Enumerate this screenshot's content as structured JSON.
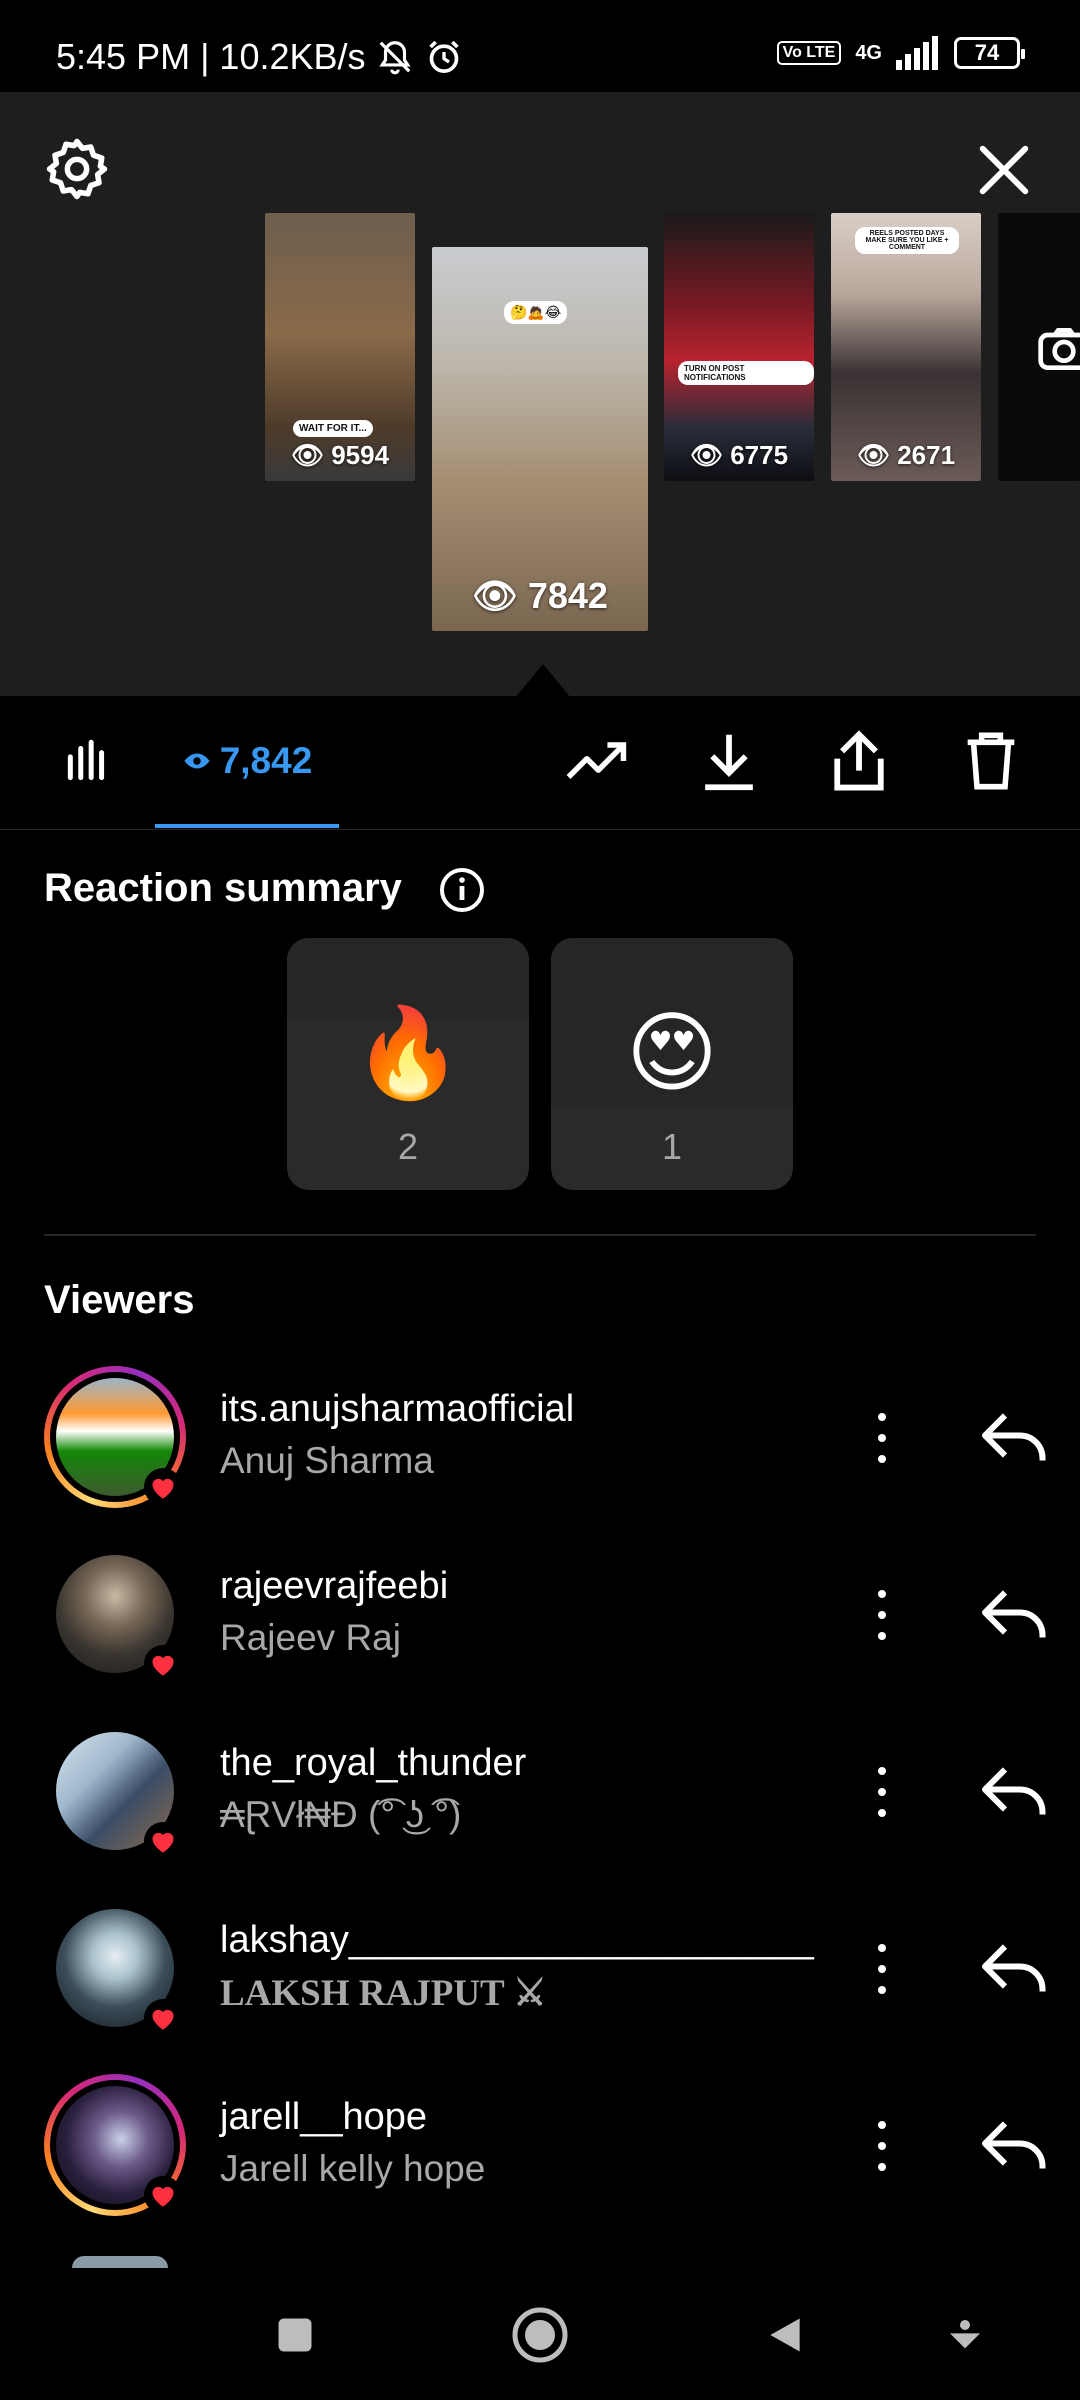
{
  "status_bar": {
    "time_speed": "5:45 PM | 10.2KB/s",
    "volte": "Vo LTE",
    "network": "4G",
    "battery": "74"
  },
  "stories": [
    {
      "views": "9594",
      "caption": "WAIT FOR IT..."
    },
    {
      "views": "7842",
      "caption": "🤔🙇😂"
    },
    {
      "views": "6775",
      "caption": "TURN ON POST NOTIFICATIONS"
    },
    {
      "views": "2671",
      "caption": "REELS POSTED DAYS MAKE SURE YOU LIKE + COMMENT"
    }
  ],
  "toolbar": {
    "views_count": "7,842"
  },
  "reaction_summary": {
    "title": "Reaction summary",
    "reactions": [
      {
        "emoji": "🔥",
        "count": "2"
      },
      {
        "emoji": "😍",
        "count": "1"
      }
    ]
  },
  "viewers": {
    "title": "Viewers",
    "items": [
      {
        "username": "its.anujsharmaofficial",
        "full_name": "Anuj Sharma"
      },
      {
        "username": "rajeevrajfeebi",
        "full_name": "Rajeev Raj"
      },
      {
        "username": "the_royal_thunder",
        "full_name": "₳ⱤVł₦Đ (͡° ͜ʖ ͡°)"
      },
      {
        "username": "lakshay______________________",
        "full_name": "LAKSH RAJPUT ⚔"
      },
      {
        "username": "jarell__hope",
        "full_name": "Jarell kelly hope"
      }
    ]
  },
  "colors": {
    "accent": "#3897f0",
    "heart": "#ff3040",
    "secondary_text": "#a8a8a8"
  }
}
